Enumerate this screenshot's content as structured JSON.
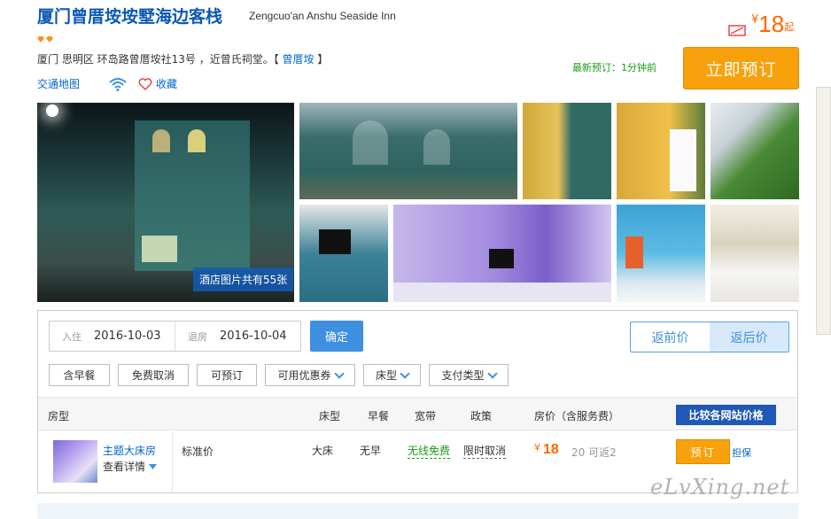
{
  "hotel": {
    "name_cn": "厦门曾厝垵垵墅海边客栈",
    "name_en": "Zengcuo'an Anshu Seaside Inn",
    "address": "厦门 思明区 环岛路曾厝垵社13号 ，近曾氏祠堂。【",
    "area_link": "曾厝垵",
    "address_end": "】",
    "map_link": "交通地图",
    "favorite": "收藏",
    "price_symbol": "¥",
    "price": "18",
    "price_suffix": "起",
    "latest_booking": "最新预订：1分钟前",
    "book_now": "立即预订"
  },
  "gallery": {
    "count_label": "酒店图片共有55张"
  },
  "search": {
    "checkin_label": "入住",
    "checkin_value": "2016-10-03",
    "checkout_label": "退房",
    "checkout_value": "2016-10-04",
    "confirm": "确定",
    "price_before": "返前价",
    "price_after": "返后价"
  },
  "filters": [
    {
      "label": "含早餐",
      "dropdown": false
    },
    {
      "label": "免费取消",
      "dropdown": false
    },
    {
      "label": "可预订",
      "dropdown": false
    },
    {
      "label": "可用优惠券",
      "dropdown": true
    },
    {
      "label": "床型",
      "dropdown": true
    },
    {
      "label": "支付类型",
      "dropdown": true
    }
  ],
  "table": {
    "headers": {
      "room": "房型",
      "bed": "床型",
      "breakfast": "早餐",
      "broadband": "宽带",
      "policy": "政策",
      "price": "房价（含服务费）",
      "compare": "比较各网站价格"
    },
    "row": {
      "room_name": "主题大床房",
      "detail": "查看详情",
      "rate_name": "标准价",
      "bed": "大床",
      "breakfast": "无早",
      "broadband": "无线免费",
      "policy": "限时取消",
      "price_symbol": "¥",
      "price": "18",
      "cashback": "20 可返2",
      "book": "预订",
      "guarantee": "担保"
    }
  },
  "watermark": "eLvXing.net"
}
